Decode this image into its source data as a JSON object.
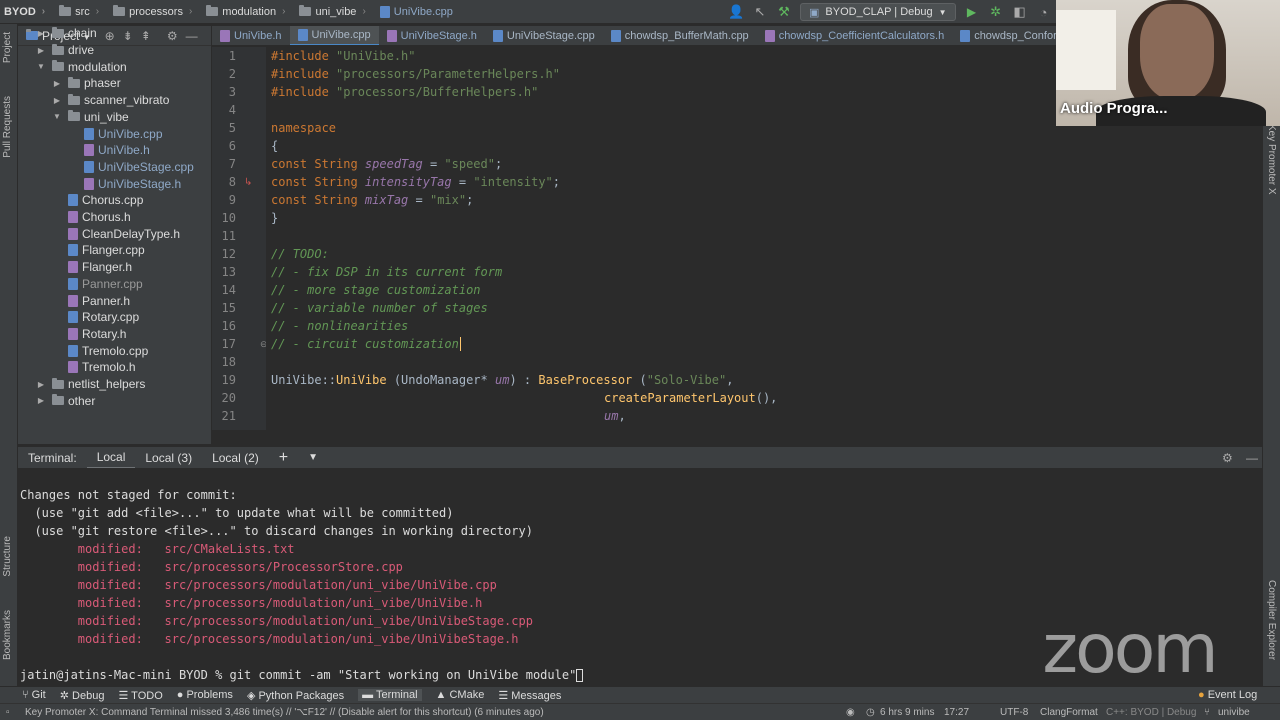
{
  "breadcrumb": [
    "BYOD",
    "src",
    "processors",
    "modulation",
    "uni_vibe",
    "UniVibe.cpp"
  ],
  "run_config": "BYOD_CLAP | Debug",
  "left_strip": {
    "project": "Project",
    "pull_requests": "Pull Requests",
    "structure": "Structure",
    "bookmarks": "Bookmarks"
  },
  "right_strip": {
    "key_promoter": "Key Promoter X",
    "compiler_explorer": "Compiler Explorer"
  },
  "project_panel": {
    "title": "Project",
    "items": [
      {
        "label": "chain",
        "kind": "folder",
        "depth": 1,
        "arrow": "▶"
      },
      {
        "label": "drive",
        "kind": "folder",
        "depth": 1,
        "arrow": "▶"
      },
      {
        "label": "modulation",
        "kind": "folder",
        "depth": 1,
        "arrow": "▼"
      },
      {
        "label": "phaser",
        "kind": "folder",
        "depth": 2,
        "arrow": "▶"
      },
      {
        "label": "scanner_vibrato",
        "kind": "folder",
        "depth": 2,
        "arrow": "▶"
      },
      {
        "label": "uni_vibe",
        "kind": "folder",
        "depth": 2,
        "arrow": "▼"
      },
      {
        "label": "UniVibe.cpp",
        "kind": "cpp",
        "depth": 3,
        "arrow": "",
        "vcs": true
      },
      {
        "label": "UniVibe.h",
        "kind": "h",
        "depth": 3,
        "arrow": "",
        "vcs": true
      },
      {
        "label": "UniVibeStage.cpp",
        "kind": "cpp",
        "depth": 3,
        "arrow": "",
        "vcs": true
      },
      {
        "label": "UniVibeStage.h",
        "kind": "h",
        "depth": 3,
        "arrow": "",
        "vcs": true
      },
      {
        "label": "Chorus.cpp",
        "kind": "cpp",
        "depth": 2,
        "arrow": ""
      },
      {
        "label": "Chorus.h",
        "kind": "h",
        "depth": 2,
        "arrow": ""
      },
      {
        "label": "CleanDelayType.h",
        "kind": "h",
        "depth": 2,
        "arrow": ""
      },
      {
        "label": "Flanger.cpp",
        "kind": "cpp",
        "depth": 2,
        "arrow": ""
      },
      {
        "label": "Flanger.h",
        "kind": "h",
        "depth": 2,
        "arrow": ""
      },
      {
        "label": "Panner.cpp",
        "kind": "cpp",
        "depth": 2,
        "arrow": "",
        "dim": true
      },
      {
        "label": "Panner.h",
        "kind": "h",
        "depth": 2,
        "arrow": ""
      },
      {
        "label": "Rotary.cpp",
        "kind": "cpp",
        "depth": 2,
        "arrow": ""
      },
      {
        "label": "Rotary.h",
        "kind": "h",
        "depth": 2,
        "arrow": ""
      },
      {
        "label": "Tremolo.cpp",
        "kind": "cpp",
        "depth": 2,
        "arrow": ""
      },
      {
        "label": "Tremolo.h",
        "kind": "h",
        "depth": 2,
        "arrow": ""
      },
      {
        "label": "netlist_helpers",
        "kind": "folder",
        "depth": 1,
        "arrow": "▶"
      },
      {
        "label": "other",
        "kind": "folder",
        "depth": 1,
        "arrow": "▶"
      }
    ]
  },
  "editor_tabs": [
    {
      "label": "UniVibe.h",
      "type": "h"
    },
    {
      "label": "UniVibe.cpp",
      "type": "cpp",
      "active": true
    },
    {
      "label": "UniVibeStage.h",
      "type": "h"
    },
    {
      "label": "UniVibeStage.cpp",
      "type": "cpp"
    },
    {
      "label": "chowdsp_BufferMath.cpp",
      "type": "cpp"
    },
    {
      "label": "chowdsp_CoefficientCalculators.h",
      "type": "h"
    },
    {
      "label": "chowdsp_Conform",
      "type": "cpp"
    }
  ],
  "line_numbers": [
    "1",
    "2",
    "3",
    "4",
    "5",
    "6",
    "7",
    "8",
    "9",
    "10",
    "11",
    "12",
    "13",
    "14",
    "15",
    "16",
    "17",
    "18",
    "19",
    "20",
    "21"
  ],
  "code": {
    "l1_kw": "#include",
    "l1_str": "\"UniVibe.h\"",
    "l2_kw": "#include",
    "l2_str": "\"processors/ParameterHelpers.h\"",
    "l3_kw": "#include",
    "l3_str": "\"processors/BufferHelpers.h\"",
    "l5": "namespace",
    "l6": "{",
    "l7_a": "const String ",
    "l7_b": "speedTag",
    "l7_c": " = ",
    "l7_d": "\"speed\"",
    "l7_e": ";",
    "l8_a": "const String ",
    "l8_b": "intensityTag",
    "l8_c": " = ",
    "l8_d": "\"intensity\"",
    "l8_e": ";",
    "l9_a": "const String ",
    "l9_b": "mixTag",
    "l9_c": " = ",
    "l9_d": "\"mix\"",
    "l9_e": ";",
    "l10": "}",
    "l12": "// TODO:",
    "l13": "// - fix DSP in its current form",
    "l14": "// - more stage customization",
    "l15": "// - variable number of stages",
    "l16": "// - nonlinearities",
    "l17": "// - circuit customization",
    "l19_a": "UniVibe::",
    "l19_b": "UniVibe",
    "l19_c": " (UndoManager* ",
    "l19_d": "um",
    "l19_e": ") : ",
    "l19_f": "BaseProcessor",
    "l19_g": " (",
    "l19_h": "\"Solo-Vibe\"",
    "l19_i": ",",
    "l20_a": "createParameterLayout",
    "l20_b": "(),",
    "l21_a": "um",
    "l21_b": ","
  },
  "terminal": {
    "title": "Terminal:",
    "tabs": [
      "Local",
      "Local (3)",
      "Local (2)"
    ],
    "lines": [
      "Changes not staged for commit:",
      "  (use \"git add <file>...\" to update what will be committed)",
      "  (use \"git restore <file>...\" to discard changes in working directory)"
    ],
    "modified": [
      "        modified:   src/CMakeLists.txt",
      "        modified:   src/processors/ProcessorStore.cpp",
      "        modified:   src/processors/modulation/uni_vibe/UniVibe.cpp",
      "        modified:   src/processors/modulation/uni_vibe/UniVibe.h",
      "        modified:   src/processors/modulation/uni_vibe/UniVibeStage.cpp",
      "        modified:   src/processors/modulation/uni_vibe/UniVibeStage.h"
    ],
    "prompt": "jatin@jatins-Mac-mini BYOD % git commit -am \"Start working on UniVibe module\""
  },
  "bottom_tools": [
    "Git",
    "Debug",
    "TODO",
    "Problems",
    "Python Packages",
    "Terminal",
    "CMake",
    "Messages",
    "Event Log"
  ],
  "status": {
    "message": "Key Promoter X: Command Terminal missed 3,486 time(s) // '⌥F12' // (Disable alert for this shortcut) (6 minutes ago)",
    "time_tracker": "6 hrs 9 mins",
    "position": "17:27",
    "encoding": "UTF-8",
    "formatter": "ClangFormat",
    "context": "C++: BYOD | Debug",
    "branch": "univibe"
  },
  "webcam": {
    "label": "Audio Progra..."
  },
  "watermark": "zoom"
}
